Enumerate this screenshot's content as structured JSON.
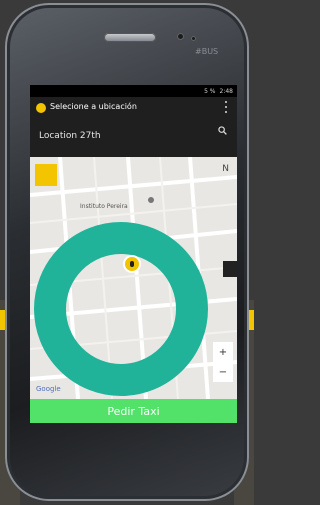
{
  "device": {
    "brand_text": "#BUS"
  },
  "status_bar": {
    "left_text": "5 %",
    "right_text": "2:48"
  },
  "app_bar": {
    "title": "Selecione a ubicación",
    "address": "Location 27th"
  },
  "map": {
    "poi_label": "Instituto Pereira",
    "compass_text": "N",
    "zoom_in": "+",
    "zoom_out": "−",
    "attribution": "Google"
  },
  "cta": {
    "label": "Pedir Taxi"
  },
  "colors": {
    "accent_yellow": "#f2c500",
    "ring_teal": "#21b39a",
    "cta_green": "#52e269",
    "app_bar": "#1f1f1f"
  }
}
